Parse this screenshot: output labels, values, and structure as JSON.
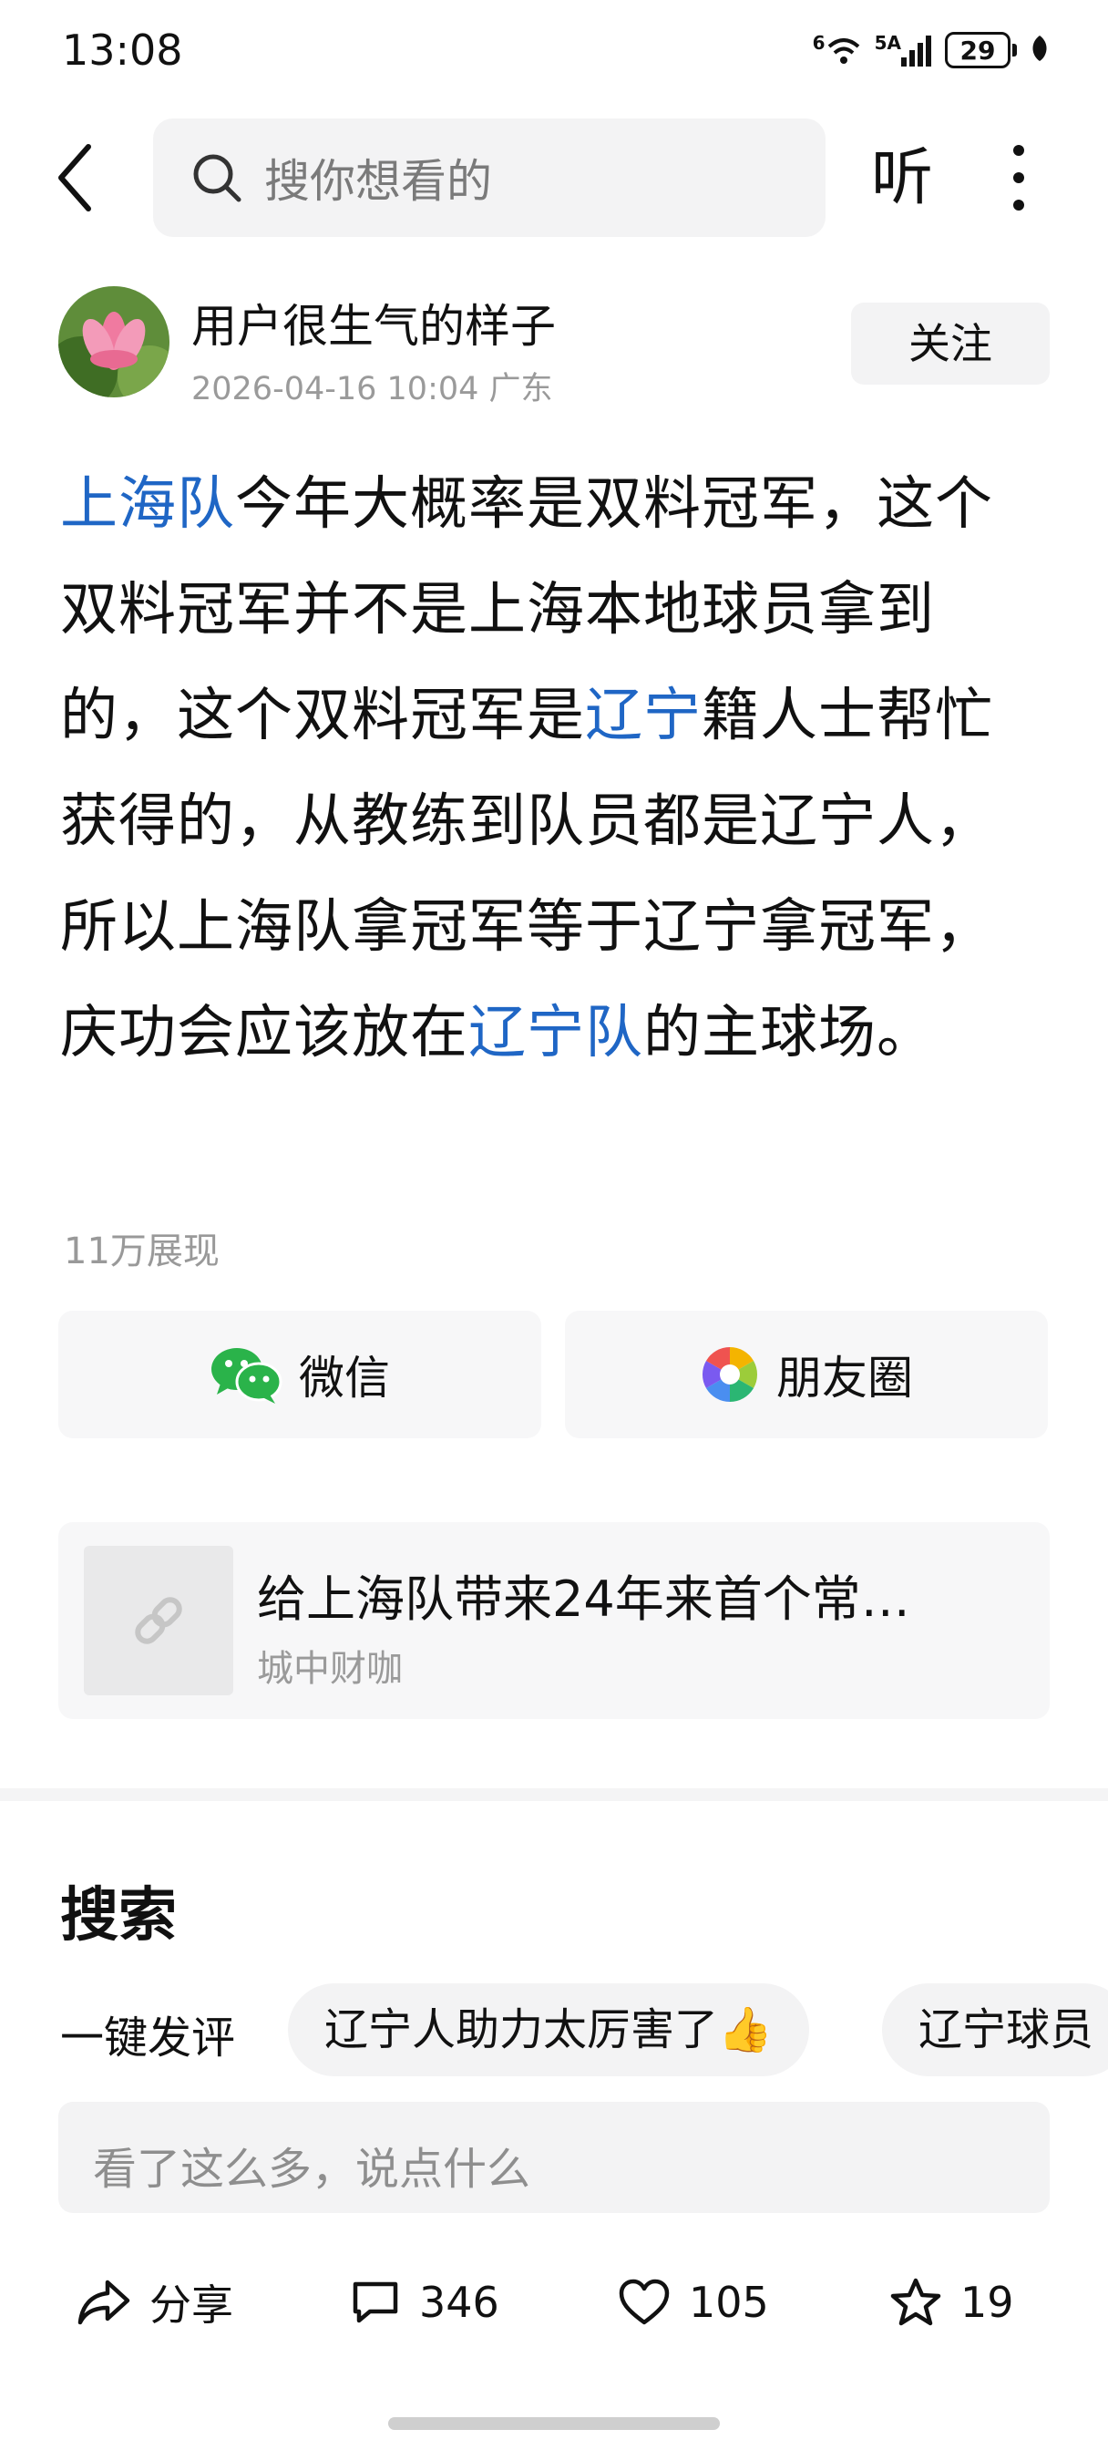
{
  "status_bar": {
    "time": "13:08",
    "network_1": "6",
    "network_2": "5A",
    "battery": "29",
    "icons": [
      "wifi-icon",
      "cell-signal-icon",
      "battery-icon",
      "leaf-icon"
    ]
  },
  "top_bar": {
    "search_placeholder": "搜你想看的",
    "listen_label": "听",
    "icons": [
      "back-arrow-icon",
      "search-icon",
      "more-icon"
    ]
  },
  "author": {
    "name": "用户很生气的样子",
    "meta": "2026-04-16 10:04 广东",
    "follow_label": "关注"
  },
  "post": {
    "segments": [
      {
        "text": "上海队",
        "link": true
      },
      {
        "text": "今年大概率是双料冠军，这个双料冠军并不是上海本地球员拿到的，这个双料冠军是",
        "link": false
      },
      {
        "text": "辽宁",
        "link": true
      },
      {
        "text": "籍人士帮忙获得的，从教练到队员都是辽宁人，所以上海队拿冠军等于辽宁拿冠军，庆功会应该放在",
        "link": false
      },
      {
        "text": "辽宁队",
        "link": true
      },
      {
        "text": "的主球场。",
        "link": false
      }
    ],
    "views": "11万展现",
    "link_color": "#1f66c5"
  },
  "share": {
    "wechat_label": "微信",
    "moments_label": "朋友圈",
    "wechat_color": "#2ab34a"
  },
  "link_card": {
    "title": "给上海队带来24年来首个常…",
    "source": "城中财咖",
    "icon": "link-icon"
  },
  "search_section": {
    "title": "搜索",
    "quick_comment_label": "一键发评",
    "chips": [
      "辽宁人助力太厉害了👍",
      "辽宁球员"
    ],
    "comment_placeholder": "看了这么多，说点什么"
  },
  "actions": {
    "share_label": "分享",
    "comments": "346",
    "likes": "105",
    "favorites": "19"
  }
}
